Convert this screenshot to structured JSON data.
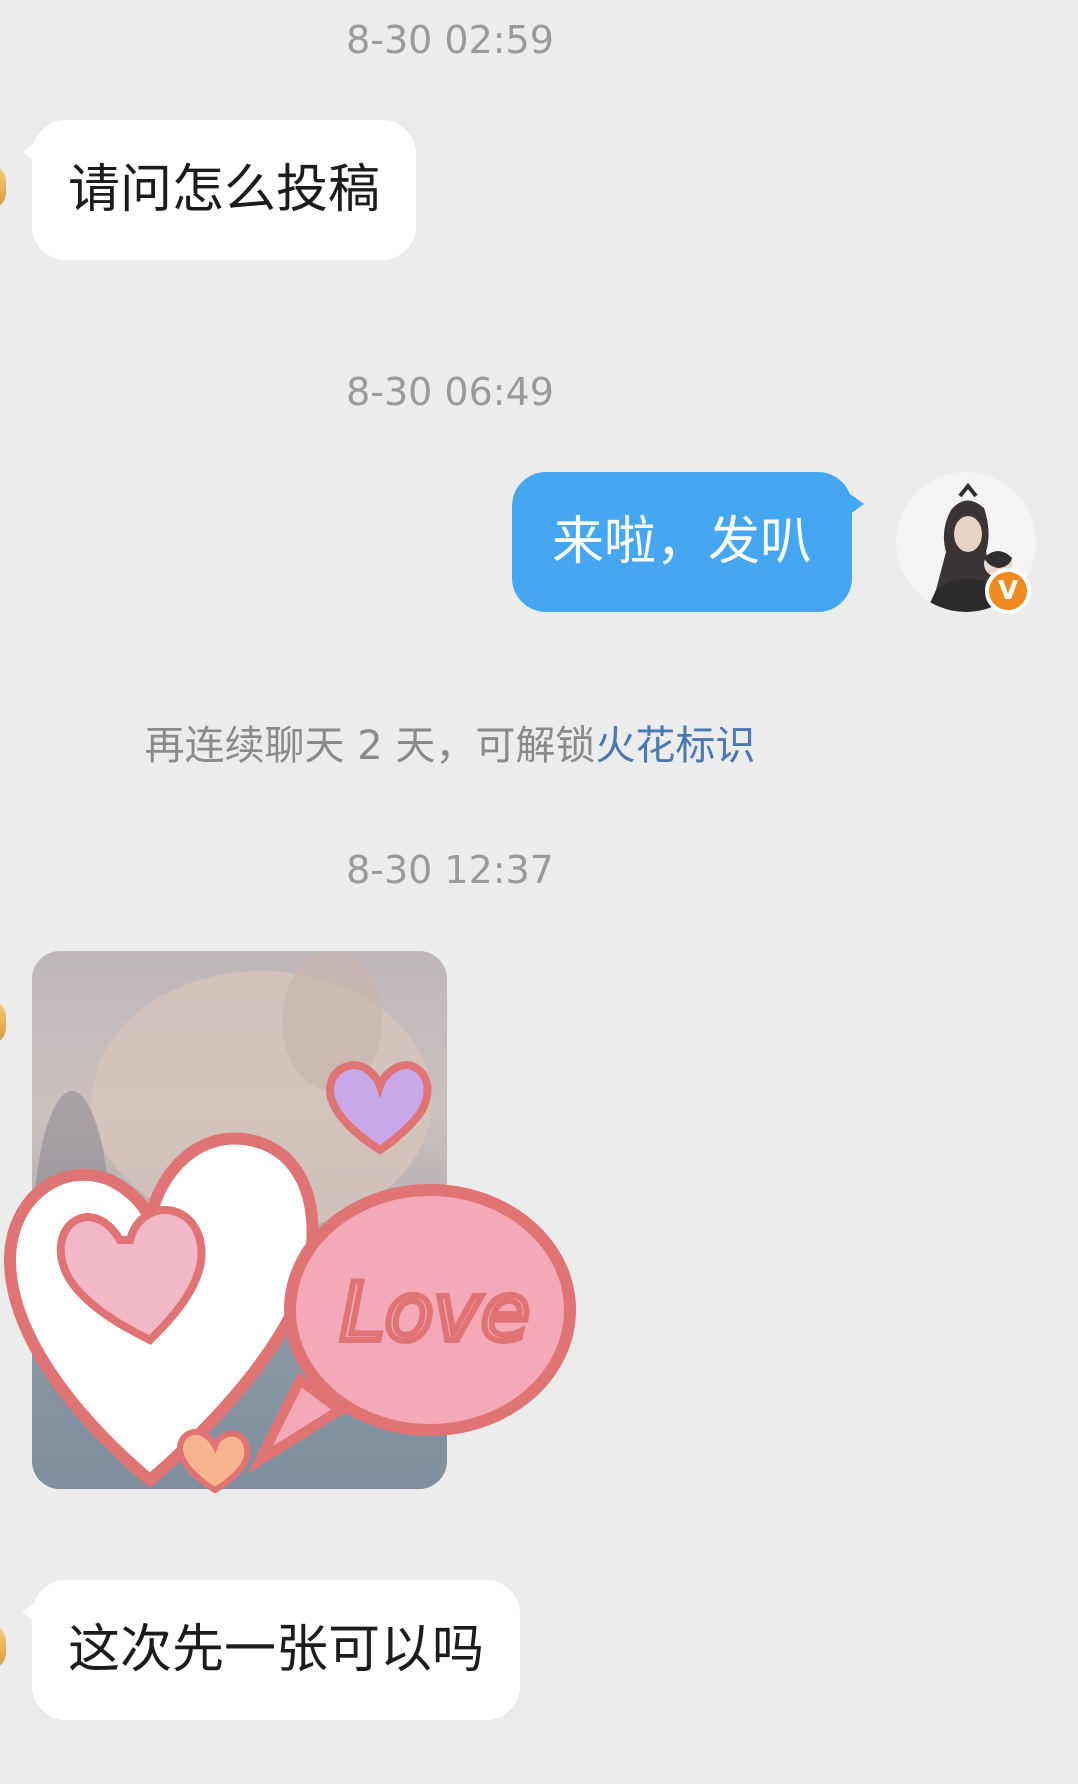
{
  "messages": {
    "timestamp_1": "8-30 02:59",
    "incoming_1": "请问怎么投稿",
    "timestamp_2": "8-30 06:49",
    "outgoing_1": "来啦，发叭",
    "system_tip": {
      "prefix": "再连续聊天 2 天，可解锁",
      "link": "火花标识"
    },
    "timestamp_3": "8-30 12:37",
    "incoming_3": "这次先一张可以吗"
  },
  "sticker": {
    "text": "Love"
  },
  "my_avatar": {
    "badge": "V"
  },
  "colors": {
    "outgoing_bubble": "#45a6f2",
    "incoming_bubble": "#ffffff",
    "background": "#ececec",
    "link": "#4a78b4",
    "verify_badge": "#f08a1f"
  }
}
